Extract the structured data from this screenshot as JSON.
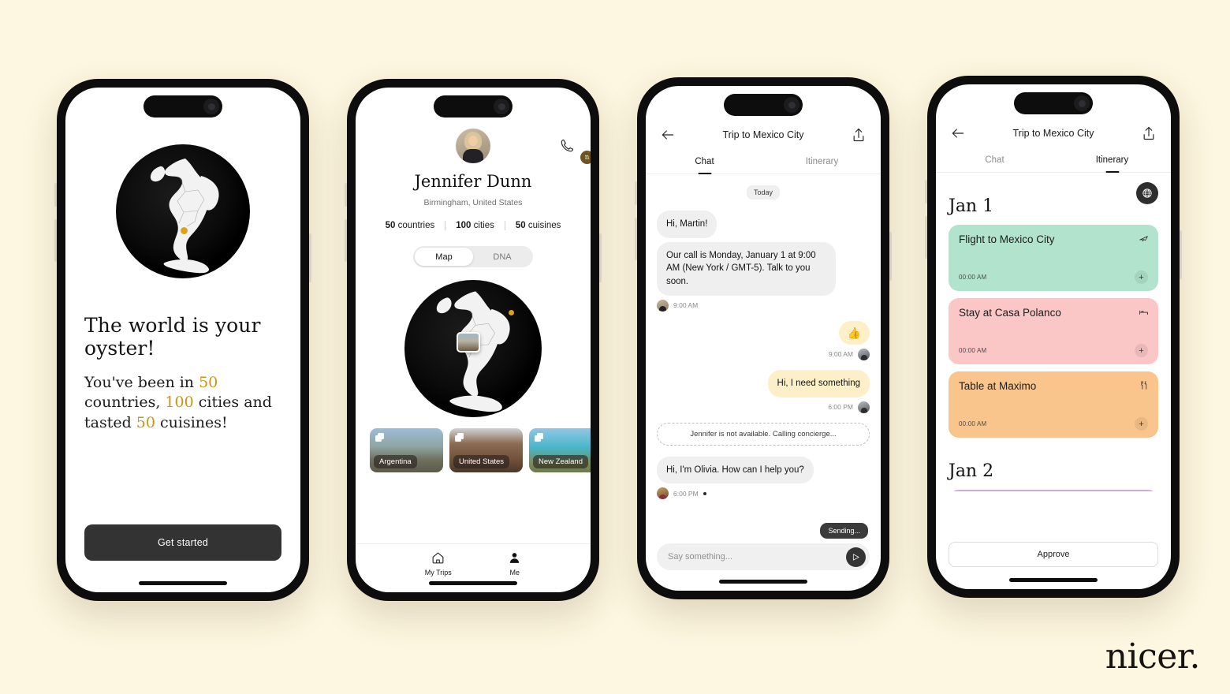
{
  "brand": {
    "wordmark": "nicer."
  },
  "onboarding": {
    "title": "The world is your oyster!",
    "sub_pre": "You've been in ",
    "countries": "50",
    "sub_mid1": " countries, ",
    "cities": "100",
    "sub_mid2": " cities and tasted ",
    "cuisines": "50",
    "sub_end": " cuisines!",
    "cta": "Get started",
    "globe_icon": "globe-south-america",
    "pin_color": "#dfa01a"
  },
  "profile": {
    "name": "Jennifer Dunn",
    "location": "Birmingham, United States",
    "badge": "n",
    "call_icon": "phone-icon",
    "stats": [
      {
        "value": "50",
        "label": " countries"
      },
      {
        "value": "100",
        "label": " cities"
      },
      {
        "value": "50",
        "label": " cuisines"
      }
    ],
    "segments": [
      {
        "label": "Map",
        "active": true
      },
      {
        "label": "DNA",
        "active": false
      }
    ],
    "cards": [
      {
        "label": "Argentina"
      },
      {
        "label": "United States"
      },
      {
        "label": "New Zealand"
      },
      {
        "label": ""
      }
    ],
    "tabs": [
      {
        "label": "My Trips",
        "icon": "home-icon",
        "active": false
      },
      {
        "label": "Me",
        "icon": "person-icon",
        "active": true
      }
    ]
  },
  "chat": {
    "title": "Trip to Mexico City",
    "back_icon": "back-arrow-icon",
    "share_icon": "share-icon",
    "tabs": [
      {
        "label": "Chat",
        "active": true
      },
      {
        "label": "Itinerary",
        "active": false
      }
    ],
    "day_divider": "Today",
    "messages": [
      {
        "side": "in",
        "text": "Hi, Martin!"
      },
      {
        "side": "in",
        "text": "Our call is Monday, January 1 at 9:00 AM (New York / GMT-5). Talk to you soon.",
        "time": "9:00 AM",
        "avatar": "j"
      },
      {
        "side": "out",
        "emoji": "👍",
        "time": "9:00 AM",
        "avatar": "m"
      },
      {
        "side": "out",
        "text": "Hi, I need something",
        "time": "6:00 PM",
        "avatar": "m"
      }
    ],
    "notice": "Jennifer is not available. Calling concierge...",
    "olivia": {
      "text": "Hi, I'm Olivia. How can I help you?",
      "time": "6:00 PM",
      "avatar": "o"
    },
    "sending": "Sending...",
    "composer_placeholder": "Say something...",
    "composer_value": "",
    "send_icon": "send-icon"
  },
  "itinerary": {
    "title": "Trip to Mexico City",
    "back_icon": "back-arrow-icon",
    "share_icon": "share-icon",
    "tabs": [
      {
        "label": "Chat",
        "active": false
      },
      {
        "label": "Itinerary",
        "active": true
      }
    ],
    "globe_fab_icon": "globe-icon",
    "days": [
      {
        "date": "Jan 1",
        "items": [
          {
            "title": "Flight to Mexico City",
            "time": "00:00 AM",
            "icon": "airplane-icon",
            "color": "#b2e3cd",
            "add": "+"
          },
          {
            "title": "Stay at Casa Polanco",
            "time": "00:00 AM",
            "icon": "bed-icon",
            "color": "#fac6c6",
            "add": "+"
          },
          {
            "title": "Table at Maximo",
            "time": "00:00 AM",
            "icon": "cutlery-icon",
            "color": "#fac58c",
            "add": "+"
          }
        ]
      },
      {
        "date": "Jan 2",
        "items": [
          {
            "title": "",
            "time": "",
            "icon": "ticket-icon",
            "color": "#ceaae0",
            "add": ""
          }
        ]
      }
    ],
    "approve": "Approve"
  }
}
